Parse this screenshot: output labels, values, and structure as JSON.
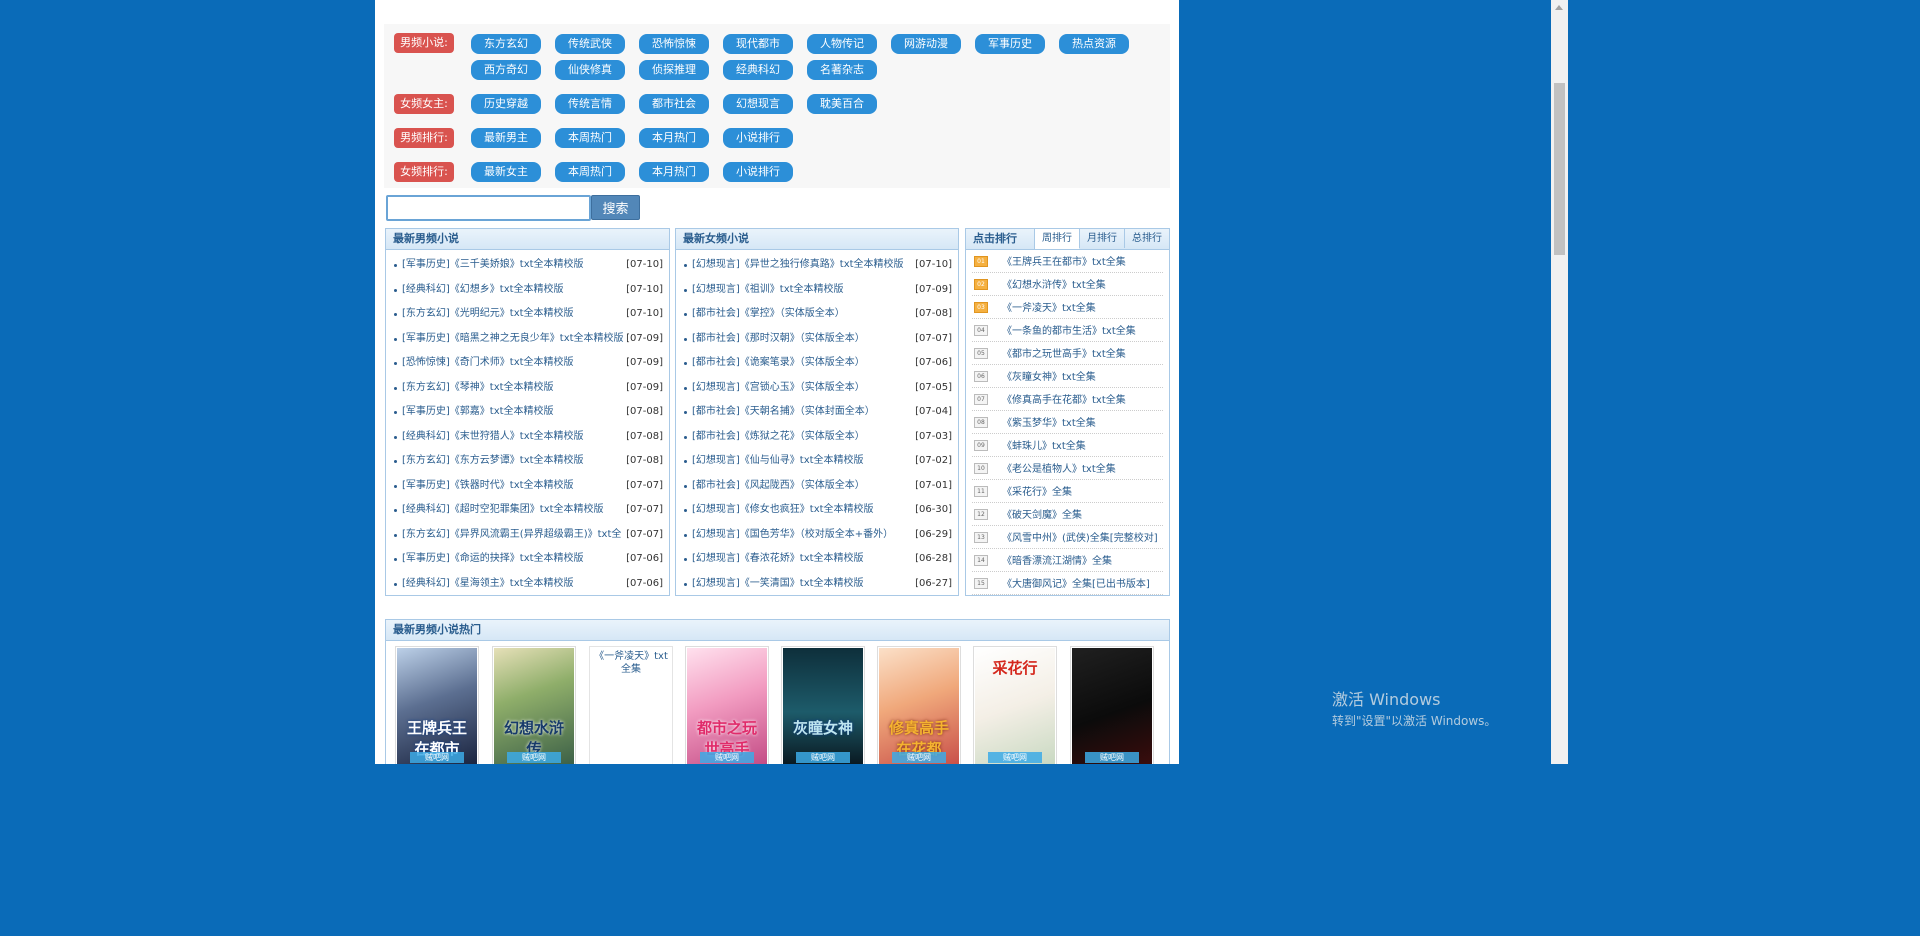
{
  "nav": {
    "rows": [
      {
        "label": "男频小说:",
        "items": [
          "东方玄幻",
          "传统武侠",
          "恐怖惊悚",
          "现代都市",
          "人物传记",
          "网游动漫",
          "军事历史",
          "热点资源",
          "西方奇幻",
          "仙侠修真",
          "侦探推理",
          "经典科幻",
          "名著杂志"
        ]
      },
      {
        "label": "女频女主:",
        "items": [
          "历史穿越",
          "传统言情",
          "都市社会",
          "幻想现言",
          "耽美百合"
        ]
      },
      {
        "label": "男频排行:",
        "items": [
          "最新男主",
          "本周热门",
          "本月热门",
          "小说排行"
        ]
      },
      {
        "label": "女频排行:",
        "items": [
          "最新女主",
          "本周热门",
          "本月热门",
          "小说排行"
        ]
      }
    ]
  },
  "search": {
    "value": "",
    "button": "搜索"
  },
  "male_new": {
    "title": "最新男频小说",
    "items": [
      {
        "text": "[军事历史]《三千美娇娘》txt全本精校版",
        "date": "[07-10]"
      },
      {
        "text": "[经典科幻]《幻想乡》txt全本精校版",
        "date": "[07-10]"
      },
      {
        "text": "[东方玄幻]《光明纪元》txt全本精校版",
        "date": "[07-10]"
      },
      {
        "text": "[军事历史]《暗黑之神之无良少年》txt全本精校版",
        "date": "[07-09]"
      },
      {
        "text": "[恐怖惊悚]《奇门术师》txt全本精校版",
        "date": "[07-09]"
      },
      {
        "text": "[东方玄幻]《琴神》txt全本精校版",
        "date": "[07-09]"
      },
      {
        "text": "[军事历史]《郭嘉》txt全本精校版",
        "date": "[07-08]"
      },
      {
        "text": "[经典科幻]《末世狩猎人》txt全本精校版",
        "date": "[07-08]"
      },
      {
        "text": "[东方玄幻]《东方云梦谭》txt全本精校版",
        "date": "[07-08]"
      },
      {
        "text": "[军事历史]《铁器时代》txt全本精校版",
        "date": "[07-07]"
      },
      {
        "text": "[经典科幻]《超时空犯罪集团》txt全本精校版",
        "date": "[07-07]"
      },
      {
        "text": "[东方玄幻]《异界风流霸王(异界超级霸王)》txt全",
        "date": "[07-07]"
      },
      {
        "text": "[军事历史]《命运的抉择》txt全本精校版",
        "date": "[07-06]"
      },
      {
        "text": "[经典科幻]《星海领主》txt全本精校版",
        "date": "[07-06]"
      }
    ]
  },
  "female_new": {
    "title": "最新女频小说",
    "items": [
      {
        "text": "[幻想现言]《异世之独行修真路》txt全本精校版",
        "date": "[07-10]"
      },
      {
        "text": "[幻想现言]《祖训》txt全本精校版",
        "date": "[07-09]"
      },
      {
        "text": "[都市社会]《掌控》（实体版全本）",
        "date": "[07-08]"
      },
      {
        "text": "[都市社会]《那时汉朝》（实体版全本）",
        "date": "[07-07]"
      },
      {
        "text": "[都市社会]《诡案笔录》（实体版全本）",
        "date": "[07-06]"
      },
      {
        "text": "[幻想现言]《宫锁心玉》（实体版全本）",
        "date": "[07-05]"
      },
      {
        "text": "[都市社会]《天朝名捕》（实体封面全本）",
        "date": "[07-04]"
      },
      {
        "text": "[都市社会]《炼狱之花》（实体版全本）",
        "date": "[07-03]"
      },
      {
        "text": "[幻想现言]《仙与仙寻》txt全本精校版",
        "date": "[07-02]"
      },
      {
        "text": "[都市社会]《风起陇西》（实体版全本）",
        "date": "[07-01]"
      },
      {
        "text": "[幻想现言]《修女也疯狂》txt全本精校版",
        "date": "[06-30]"
      },
      {
        "text": "[幻想现言]《国色芳华》（校对版全本+番外）",
        "date": "[06-29]"
      },
      {
        "text": "[幻想现言]《春浓花娇》txt全本精校版",
        "date": "[06-28]"
      },
      {
        "text": "[幻想现言]《一笑清国》txt全本精校版",
        "date": "[06-27]"
      }
    ]
  },
  "rank": {
    "title": "点击排行",
    "tabs": [
      "周排行",
      "月排行",
      "总排行"
    ],
    "items": [
      {
        "num": "01",
        "text": "《王牌兵王在都市》txt全集"
      },
      {
        "num": "02",
        "text": "《幻想水浒传》txt全集"
      },
      {
        "num": "03",
        "text": "《一斧凌天》txt全集"
      },
      {
        "num": "04",
        "text": "《一条鱼的都市生活》txt全集"
      },
      {
        "num": "05",
        "text": "《都市之玩世高手》txt全集"
      },
      {
        "num": "06",
        "text": "《灰瞳女神》txt全集"
      },
      {
        "num": "07",
        "text": "《修真高手在花都》txt全集"
      },
      {
        "num": "08",
        "text": "《紫玉梦华》txt全集"
      },
      {
        "num": "09",
        "text": "《蚌珠儿》txt全集"
      },
      {
        "num": "10",
        "text": "《老公是植物人》txt全集"
      },
      {
        "num": "11",
        "text": "《采花行》全集"
      },
      {
        "num": "12",
        "text": "《破天剑魔》全集"
      },
      {
        "num": "13",
        "text": "《风雪中州》(武侠)全集[完整校对]"
      },
      {
        "num": "14",
        "text": "《暗香漂流江湖情》全集"
      },
      {
        "num": "15",
        "text": "《大唐御风记》全集[已出书版本]"
      }
    ]
  },
  "hot": {
    "title": "最新男频小说热门",
    "broken_alt": "《一斧凌天》txt全集",
    "covers": [
      {
        "title": "王牌兵王在都市",
        "watermark": "贼吧网"
      },
      {
        "title": "幻想水浒传",
        "watermark": "贼吧网"
      },
      {
        "title": "都市之玩世高手",
        "watermark": "贼吧网"
      },
      {
        "title": "灰瞳女神",
        "watermark": "贼吧网"
      },
      {
        "title": "修真高手在花都",
        "watermark": "贼吧网"
      },
      {
        "title": "采花行",
        "watermark": "贼吧网"
      },
      {
        "title": "",
        "watermark": "贼吧网"
      }
    ]
  },
  "windows": {
    "title": "激活 Windows",
    "subtitle": "转到\"设置\"以激活 Windows。"
  }
}
